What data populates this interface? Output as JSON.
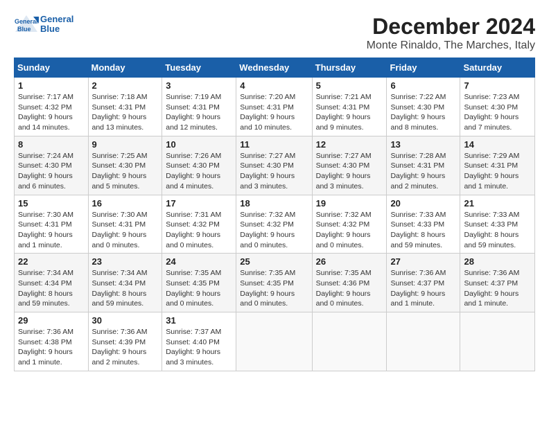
{
  "header": {
    "logo_general": "General",
    "logo_blue": "Blue",
    "title": "December 2024",
    "subtitle": "Monte Rinaldo, The Marches, Italy"
  },
  "days_of_week": [
    "Sunday",
    "Monday",
    "Tuesday",
    "Wednesday",
    "Thursday",
    "Friday",
    "Saturday"
  ],
  "weeks": [
    [
      {
        "date": "1",
        "sunrise": "Sunrise: 7:17 AM",
        "sunset": "Sunset: 4:32 PM",
        "daylight": "Daylight: 9 hours and 14 minutes."
      },
      {
        "date": "2",
        "sunrise": "Sunrise: 7:18 AM",
        "sunset": "Sunset: 4:31 PM",
        "daylight": "Daylight: 9 hours and 13 minutes."
      },
      {
        "date": "3",
        "sunrise": "Sunrise: 7:19 AM",
        "sunset": "Sunset: 4:31 PM",
        "daylight": "Daylight: 9 hours and 12 minutes."
      },
      {
        "date": "4",
        "sunrise": "Sunrise: 7:20 AM",
        "sunset": "Sunset: 4:31 PM",
        "daylight": "Daylight: 9 hours and 10 minutes."
      },
      {
        "date": "5",
        "sunrise": "Sunrise: 7:21 AM",
        "sunset": "Sunset: 4:31 PM",
        "daylight": "Daylight: 9 hours and 9 minutes."
      },
      {
        "date": "6",
        "sunrise": "Sunrise: 7:22 AM",
        "sunset": "Sunset: 4:30 PM",
        "daylight": "Daylight: 9 hours and 8 minutes."
      },
      {
        "date": "7",
        "sunrise": "Sunrise: 7:23 AM",
        "sunset": "Sunset: 4:30 PM",
        "daylight": "Daylight: 9 hours and 7 minutes."
      }
    ],
    [
      {
        "date": "8",
        "sunrise": "Sunrise: 7:24 AM",
        "sunset": "Sunset: 4:30 PM",
        "daylight": "Daylight: 9 hours and 6 minutes."
      },
      {
        "date": "9",
        "sunrise": "Sunrise: 7:25 AM",
        "sunset": "Sunset: 4:30 PM",
        "daylight": "Daylight: 9 hours and 5 minutes."
      },
      {
        "date": "10",
        "sunrise": "Sunrise: 7:26 AM",
        "sunset": "Sunset: 4:30 PM",
        "daylight": "Daylight: 9 hours and 4 minutes."
      },
      {
        "date": "11",
        "sunrise": "Sunrise: 7:27 AM",
        "sunset": "Sunset: 4:30 PM",
        "daylight": "Daylight: 9 hours and 3 minutes."
      },
      {
        "date": "12",
        "sunrise": "Sunrise: 7:27 AM",
        "sunset": "Sunset: 4:30 PM",
        "daylight": "Daylight: 9 hours and 3 minutes."
      },
      {
        "date": "13",
        "sunrise": "Sunrise: 7:28 AM",
        "sunset": "Sunset: 4:31 PM",
        "daylight": "Daylight: 9 hours and 2 minutes."
      },
      {
        "date": "14",
        "sunrise": "Sunrise: 7:29 AM",
        "sunset": "Sunset: 4:31 PM",
        "daylight": "Daylight: 9 hours and 1 minute."
      }
    ],
    [
      {
        "date": "15",
        "sunrise": "Sunrise: 7:30 AM",
        "sunset": "Sunset: 4:31 PM",
        "daylight": "Daylight: 9 hours and 1 minute."
      },
      {
        "date": "16",
        "sunrise": "Sunrise: 7:30 AM",
        "sunset": "Sunset: 4:31 PM",
        "daylight": "Daylight: 9 hours and 0 minutes."
      },
      {
        "date": "17",
        "sunrise": "Sunrise: 7:31 AM",
        "sunset": "Sunset: 4:32 PM",
        "daylight": "Daylight: 9 hours and 0 minutes."
      },
      {
        "date": "18",
        "sunrise": "Sunrise: 7:32 AM",
        "sunset": "Sunset: 4:32 PM",
        "daylight": "Daylight: 9 hours and 0 minutes."
      },
      {
        "date": "19",
        "sunrise": "Sunrise: 7:32 AM",
        "sunset": "Sunset: 4:32 PM",
        "daylight": "Daylight: 9 hours and 0 minutes."
      },
      {
        "date": "20",
        "sunrise": "Sunrise: 7:33 AM",
        "sunset": "Sunset: 4:33 PM",
        "daylight": "Daylight: 8 hours and 59 minutes."
      },
      {
        "date": "21",
        "sunrise": "Sunrise: 7:33 AM",
        "sunset": "Sunset: 4:33 PM",
        "daylight": "Daylight: 8 hours and 59 minutes."
      }
    ],
    [
      {
        "date": "22",
        "sunrise": "Sunrise: 7:34 AM",
        "sunset": "Sunset: 4:34 PM",
        "daylight": "Daylight: 8 hours and 59 minutes."
      },
      {
        "date": "23",
        "sunrise": "Sunrise: 7:34 AM",
        "sunset": "Sunset: 4:34 PM",
        "daylight": "Daylight: 8 hours and 59 minutes."
      },
      {
        "date": "24",
        "sunrise": "Sunrise: 7:35 AM",
        "sunset": "Sunset: 4:35 PM",
        "daylight": "Daylight: 9 hours and 0 minutes."
      },
      {
        "date": "25",
        "sunrise": "Sunrise: 7:35 AM",
        "sunset": "Sunset: 4:35 PM",
        "daylight": "Daylight: 9 hours and 0 minutes."
      },
      {
        "date": "26",
        "sunrise": "Sunrise: 7:35 AM",
        "sunset": "Sunset: 4:36 PM",
        "daylight": "Daylight: 9 hours and 0 minutes."
      },
      {
        "date": "27",
        "sunrise": "Sunrise: 7:36 AM",
        "sunset": "Sunset: 4:37 PM",
        "daylight": "Daylight: 9 hours and 1 minute."
      },
      {
        "date": "28",
        "sunrise": "Sunrise: 7:36 AM",
        "sunset": "Sunset: 4:37 PM",
        "daylight": "Daylight: 9 hours and 1 minute."
      }
    ],
    [
      {
        "date": "29",
        "sunrise": "Sunrise: 7:36 AM",
        "sunset": "Sunset: 4:38 PM",
        "daylight": "Daylight: 9 hours and 1 minute."
      },
      {
        "date": "30",
        "sunrise": "Sunrise: 7:36 AM",
        "sunset": "Sunset: 4:39 PM",
        "daylight": "Daylight: 9 hours and 2 minutes."
      },
      {
        "date": "31",
        "sunrise": "Sunrise: 7:37 AM",
        "sunset": "Sunset: 4:40 PM",
        "daylight": "Daylight: 9 hours and 3 minutes."
      },
      null,
      null,
      null,
      null
    ]
  ]
}
